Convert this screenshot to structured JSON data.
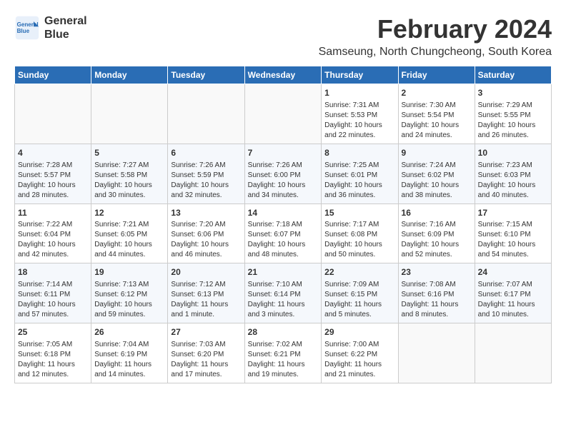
{
  "header": {
    "logo_line1": "General",
    "logo_line2": "Blue",
    "title": "February 2024",
    "subtitle": "Samseung, North Chungcheong, South Korea"
  },
  "days_of_week": [
    "Sunday",
    "Monday",
    "Tuesday",
    "Wednesday",
    "Thursday",
    "Friday",
    "Saturday"
  ],
  "weeks": [
    [
      {
        "day": "",
        "info": ""
      },
      {
        "day": "",
        "info": ""
      },
      {
        "day": "",
        "info": ""
      },
      {
        "day": "",
        "info": ""
      },
      {
        "day": "1",
        "info": "Sunrise: 7:31 AM\nSunset: 5:53 PM\nDaylight: 10 hours\nand 22 minutes."
      },
      {
        "day": "2",
        "info": "Sunrise: 7:30 AM\nSunset: 5:54 PM\nDaylight: 10 hours\nand 24 minutes."
      },
      {
        "day": "3",
        "info": "Sunrise: 7:29 AM\nSunset: 5:55 PM\nDaylight: 10 hours\nand 26 minutes."
      }
    ],
    [
      {
        "day": "4",
        "info": "Sunrise: 7:28 AM\nSunset: 5:57 PM\nDaylight: 10 hours\nand 28 minutes."
      },
      {
        "day": "5",
        "info": "Sunrise: 7:27 AM\nSunset: 5:58 PM\nDaylight: 10 hours\nand 30 minutes."
      },
      {
        "day": "6",
        "info": "Sunrise: 7:26 AM\nSunset: 5:59 PM\nDaylight: 10 hours\nand 32 minutes."
      },
      {
        "day": "7",
        "info": "Sunrise: 7:26 AM\nSunset: 6:00 PM\nDaylight: 10 hours\nand 34 minutes."
      },
      {
        "day": "8",
        "info": "Sunrise: 7:25 AM\nSunset: 6:01 PM\nDaylight: 10 hours\nand 36 minutes."
      },
      {
        "day": "9",
        "info": "Sunrise: 7:24 AM\nSunset: 6:02 PM\nDaylight: 10 hours\nand 38 minutes."
      },
      {
        "day": "10",
        "info": "Sunrise: 7:23 AM\nSunset: 6:03 PM\nDaylight: 10 hours\nand 40 minutes."
      }
    ],
    [
      {
        "day": "11",
        "info": "Sunrise: 7:22 AM\nSunset: 6:04 PM\nDaylight: 10 hours\nand 42 minutes."
      },
      {
        "day": "12",
        "info": "Sunrise: 7:21 AM\nSunset: 6:05 PM\nDaylight: 10 hours\nand 44 minutes."
      },
      {
        "day": "13",
        "info": "Sunrise: 7:20 AM\nSunset: 6:06 PM\nDaylight: 10 hours\nand 46 minutes."
      },
      {
        "day": "14",
        "info": "Sunrise: 7:18 AM\nSunset: 6:07 PM\nDaylight: 10 hours\nand 48 minutes."
      },
      {
        "day": "15",
        "info": "Sunrise: 7:17 AM\nSunset: 6:08 PM\nDaylight: 10 hours\nand 50 minutes."
      },
      {
        "day": "16",
        "info": "Sunrise: 7:16 AM\nSunset: 6:09 PM\nDaylight: 10 hours\nand 52 minutes."
      },
      {
        "day": "17",
        "info": "Sunrise: 7:15 AM\nSunset: 6:10 PM\nDaylight: 10 hours\nand 54 minutes."
      }
    ],
    [
      {
        "day": "18",
        "info": "Sunrise: 7:14 AM\nSunset: 6:11 PM\nDaylight: 10 hours\nand 57 minutes."
      },
      {
        "day": "19",
        "info": "Sunrise: 7:13 AM\nSunset: 6:12 PM\nDaylight: 10 hours\nand 59 minutes."
      },
      {
        "day": "20",
        "info": "Sunrise: 7:12 AM\nSunset: 6:13 PM\nDaylight: 11 hours\nand 1 minute."
      },
      {
        "day": "21",
        "info": "Sunrise: 7:10 AM\nSunset: 6:14 PM\nDaylight: 11 hours\nand 3 minutes."
      },
      {
        "day": "22",
        "info": "Sunrise: 7:09 AM\nSunset: 6:15 PM\nDaylight: 11 hours\nand 5 minutes."
      },
      {
        "day": "23",
        "info": "Sunrise: 7:08 AM\nSunset: 6:16 PM\nDaylight: 11 hours\nand 8 minutes."
      },
      {
        "day": "24",
        "info": "Sunrise: 7:07 AM\nSunset: 6:17 PM\nDaylight: 11 hours\nand 10 minutes."
      }
    ],
    [
      {
        "day": "25",
        "info": "Sunrise: 7:05 AM\nSunset: 6:18 PM\nDaylight: 11 hours\nand 12 minutes."
      },
      {
        "day": "26",
        "info": "Sunrise: 7:04 AM\nSunset: 6:19 PM\nDaylight: 11 hours\nand 14 minutes."
      },
      {
        "day": "27",
        "info": "Sunrise: 7:03 AM\nSunset: 6:20 PM\nDaylight: 11 hours\nand 17 minutes."
      },
      {
        "day": "28",
        "info": "Sunrise: 7:02 AM\nSunset: 6:21 PM\nDaylight: 11 hours\nand 19 minutes."
      },
      {
        "day": "29",
        "info": "Sunrise: 7:00 AM\nSunset: 6:22 PM\nDaylight: 11 hours\nand 21 minutes."
      },
      {
        "day": "",
        "info": ""
      },
      {
        "day": "",
        "info": ""
      }
    ]
  ]
}
